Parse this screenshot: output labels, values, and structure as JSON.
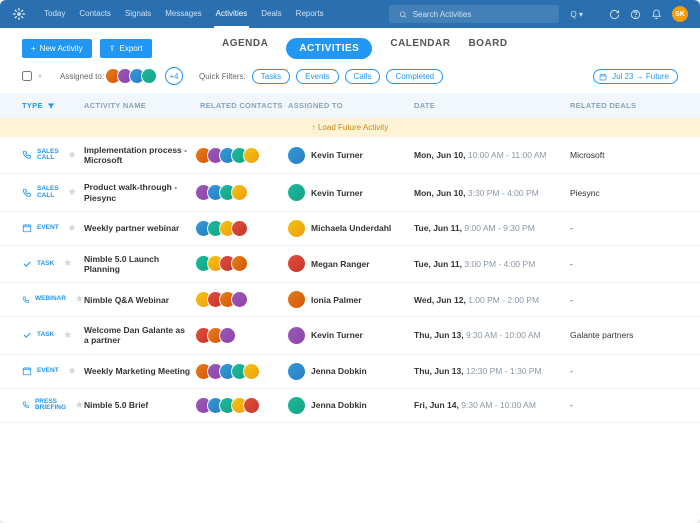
{
  "top": {
    "nav": [
      "Today",
      "Contacts",
      "Signals",
      "Messages",
      "Activities",
      "Deals",
      "Reports"
    ],
    "active": 4,
    "search_placeholder": "Search Activities",
    "avatar_initials": "SK"
  },
  "subbar": {
    "new_label": "New Activity",
    "export_label": "Export",
    "views": [
      "AGENDA",
      "ACTIVITIES",
      "CALENDAR",
      "BOARD"
    ],
    "view_active": 1
  },
  "filters": {
    "assigned_label": "Assigned to:",
    "more_label": "+4",
    "quick_label": "Quick Filters:",
    "chips": [
      "Tasks",
      "Events",
      "Calls",
      "Completed"
    ],
    "range": "Jul 23 → Future"
  },
  "columns": [
    "TYPE",
    "ACTIVITY NAME",
    "RELATED CONTACTS",
    "ASSIGNED TO",
    "DATE",
    "RELATED DEALS"
  ],
  "load_label": "↑ Load Future Activity",
  "rows": [
    {
      "type": "SALES CALL",
      "icon": "phone",
      "name": "Implementation process - Microsoft",
      "contacts": 5,
      "assigned": "Kevin Turner",
      "date": "Mon, Jun 10,",
      "time": "10:00 AM - 11:00 AM",
      "deal": "Microsoft"
    },
    {
      "type": "SALES CALL",
      "icon": "phone",
      "name": "Product walk-through - Piesync",
      "contacts": 4,
      "assigned": "Kevin Turner",
      "date": "Mon, Jun 10,",
      "time": "3:30 PM - 4:00 PM",
      "deal": "Piesync"
    },
    {
      "type": "EVENT",
      "icon": "calendar",
      "name": "Weekly partner webinar",
      "contacts": 4,
      "assigned": "Michaela Underdahl",
      "date": "Tue, Jun 11,",
      "time": "9:00 AM - 9:30 PM",
      "deal": "-"
    },
    {
      "type": "TASK",
      "icon": "check",
      "name": "Nimble 5.0 Launch Planning",
      "contacts": 4,
      "assigned": "Megan Ranger",
      "date": "Tue, Jun 11,",
      "time": "3:00 PM - 4:00 PM",
      "deal": "-"
    },
    {
      "type": "WEBINAR",
      "icon": "phone",
      "name": "Nimble Q&A Webinar",
      "contacts": 4,
      "assigned": "Ionia Palmer",
      "date": "Wed, Jun 12,",
      "time": "1:00 PM - 2:00 PM",
      "deal": "-"
    },
    {
      "type": "TASK",
      "icon": "check",
      "name": "Welcome Dan Galante as a partner",
      "contacts": 3,
      "assigned": "Kevin Turner",
      "date": "Thu, Jun 13,",
      "time": "9:30 AM - 10:00 AM",
      "deal": "Galante partners"
    },
    {
      "type": "EVENT",
      "icon": "calendar",
      "name": "Weekly Marketing Meeting",
      "contacts": 5,
      "assigned": "Jenna Dobkin",
      "date": "Thu, Jun 13,",
      "time": "12:30 PM - 1:30 PM",
      "deal": "-"
    },
    {
      "type": "PRESS BRIEFING",
      "icon": "phone",
      "name": "Nimble 5.0 Brief",
      "contacts": 5,
      "assigned": "Jenna Dobkin",
      "date": "Fri, Jun 14,",
      "time": "9:30 AM - 10:00 AM",
      "deal": "-"
    }
  ]
}
